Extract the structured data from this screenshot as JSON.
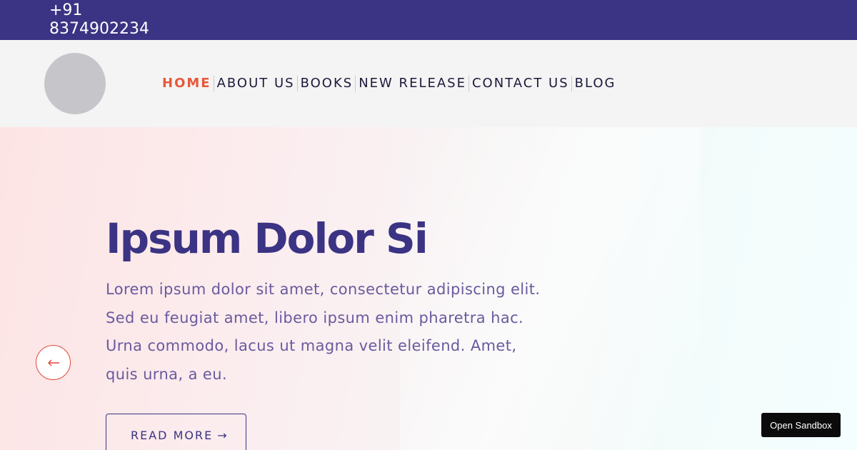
{
  "topbar": {
    "phone_icon": "phone-icon",
    "phone": "+91 8374902234",
    "social": [
      "facebook-icon",
      "twitter-icon",
      "linkedin-icon",
      "instagram-icon",
      "youtube-icon"
    ]
  },
  "header": {
    "nav": [
      "HOME",
      "ABOUT US",
      "BOOKS",
      "NEW RELEASE",
      "CONTACT US",
      "BLOG"
    ],
    "active": "HOME"
  },
  "hero": {
    "title": "Ipsum Dolor Si",
    "text": "Lorem ipsum dolor sit amet, consectetur adipiscing elit. Sed eu feugiat amet, libero ipsum enim pharetra hac. Urna commodo, lacus ut magna velit eleifend. Amet, quis urna, a eu.",
    "cta": "READ MORE",
    "cta_arrow": "→",
    "prev_icon": "arrow-left-icon"
  },
  "sandbox": {
    "label": "Open Sandbox"
  },
  "colors": {
    "primary": "#3b3383",
    "accent": "#e8583a",
    "text": "#6a5a9e"
  }
}
